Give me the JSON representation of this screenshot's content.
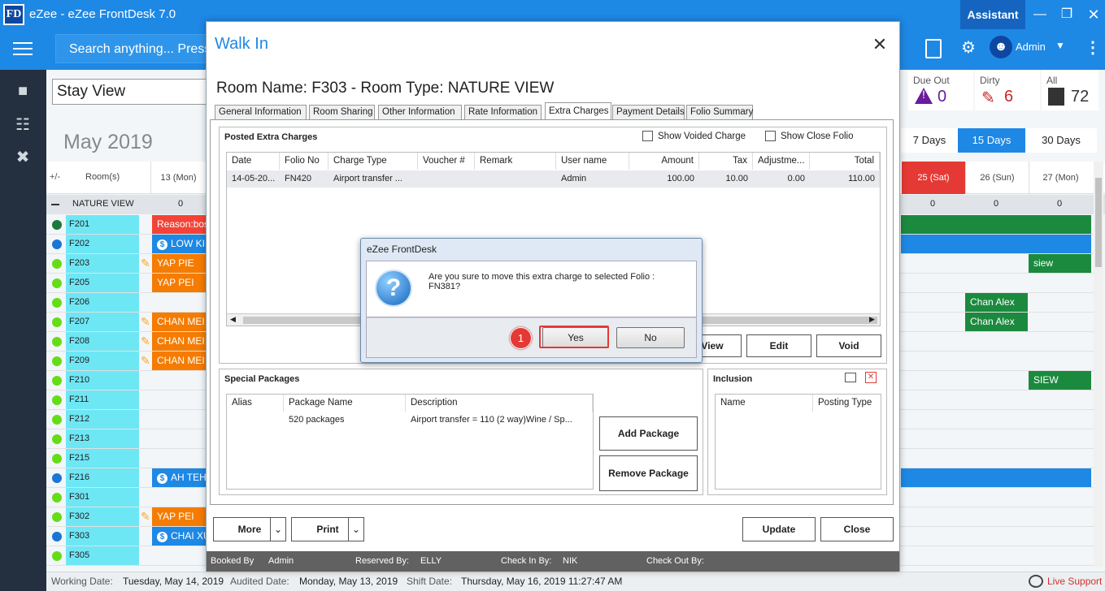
{
  "app": {
    "logo": "FD",
    "title": "eZee - eZee FrontDesk 7.0",
    "assistant_label": "Assistant",
    "user": "Admin"
  },
  "search": {
    "placeholder": "Search anything... Press"
  },
  "view": {
    "selected": "Stay View",
    "month": "May 2019"
  },
  "stats": {
    "due_out": {
      "label": "Due Out",
      "value": "0"
    },
    "dirty": {
      "label": "Dirty",
      "value": "6"
    },
    "all": {
      "label": "All",
      "value": "72"
    }
  },
  "range_buttons": [
    "7 Days",
    "15 Days",
    "30 Days"
  ],
  "grid": {
    "plusminus": "+/-",
    "rooms_header": "Room(s)",
    "dates": [
      "13 (Mon)",
      "25 (Sat)",
      "26 (Sun)",
      "27 (Mon)"
    ],
    "group": {
      "name": "NATURE VIEW",
      "counts": [
        "0",
        "0",
        "0",
        "0"
      ]
    },
    "rooms": [
      {
        "name": "F201",
        "dot": "#1b7a3a",
        "booking": "Reason:bos",
        "bcolor": "#f44336",
        "dollar": false,
        "broom": false
      },
      {
        "name": "F202",
        "dot": "#1976d2",
        "booking": "LOW KI",
        "bcolor": "#1e88e5",
        "dollar": true,
        "broom": false
      },
      {
        "name": "F203",
        "dot": "#64dd17",
        "booking": "YAP PIE",
        "bcolor": "#f57c00",
        "dollar": false,
        "broom": true
      },
      {
        "name": "F205",
        "dot": "#64dd17",
        "booking": "YAP PEI",
        "bcolor": "#f57c00",
        "dollar": false,
        "broom": false
      },
      {
        "name": "F206",
        "dot": "#64dd17",
        "booking": "",
        "bcolor": "",
        "dollar": false,
        "broom": false
      },
      {
        "name": "F207",
        "dot": "#64dd17",
        "booking": "CHAN MEI",
        "bcolor": "#f57c00",
        "dollar": false,
        "broom": true
      },
      {
        "name": "F208",
        "dot": "#64dd17",
        "booking": "CHAN MEI",
        "bcolor": "#f57c00",
        "dollar": false,
        "broom": true
      },
      {
        "name": "F209",
        "dot": "#64dd17",
        "booking": "CHAN MEI",
        "bcolor": "#f57c00",
        "dollar": false,
        "broom": true
      },
      {
        "name": "F210",
        "dot": "#64dd17",
        "booking": "",
        "bcolor": "",
        "dollar": false,
        "broom": false
      },
      {
        "name": "F211",
        "dot": "#64dd17",
        "booking": "",
        "bcolor": "",
        "dollar": false,
        "broom": false
      },
      {
        "name": "F212",
        "dot": "#64dd17",
        "booking": "",
        "bcolor": "",
        "dollar": false,
        "broom": false
      },
      {
        "name": "F213",
        "dot": "#64dd17",
        "booking": "",
        "bcolor": "",
        "dollar": false,
        "broom": false
      },
      {
        "name": "F215",
        "dot": "#64dd17",
        "booking": "",
        "bcolor": "",
        "dollar": false,
        "broom": false
      },
      {
        "name": "F216",
        "dot": "#1976d2",
        "booking": "AH TEH",
        "bcolor": "#1e88e5",
        "dollar": true,
        "broom": false
      },
      {
        "name": "F301",
        "dot": "#64dd17",
        "booking": "",
        "bcolor": "",
        "dollar": false,
        "broom": false
      },
      {
        "name": "F302",
        "dot": "#64dd17",
        "booking": "YAP PEI",
        "bcolor": "#f57c00",
        "dollar": false,
        "broom": true
      },
      {
        "name": "F303",
        "dot": "#1976d2",
        "booking": "CHAI XU",
        "bcolor": "#1e88e5",
        "dollar": true,
        "broom": false
      },
      {
        "name": "F305",
        "dot": "#64dd17",
        "booking": "",
        "bcolor": "",
        "dollar": false,
        "broom": false
      }
    ],
    "right_bookings": {
      "f203": "siew",
      "f207": "Chan Alex",
      "f208": "Chan Alex",
      "f210": "SIEW"
    }
  },
  "status": {
    "working_label": "Working Date:",
    "working": "Tuesday, May 14, 2019",
    "audited_label": "Audited Date:",
    "audited": "Monday, May 13, 2019",
    "shift_label": "Shift Date:",
    "shift": "Thursday, May 16, 2019 11:27:47 AM",
    "live_support": "Live Support"
  },
  "walkin": {
    "title": "Walk In",
    "room_title": "Room Name: F303 - Room Type: NATURE VIEW",
    "tabs": [
      "General Information",
      "Room Sharing",
      "Other Information",
      "Rate Information",
      "Extra Charges",
      "Payment Details",
      "Folio Summary"
    ],
    "posted": {
      "title": "Posted Extra Charges",
      "show_voided": "Show Voided Charge",
      "show_close_folio": "Show Close Folio",
      "headers": [
        "Date",
        "Folio No",
        "Charge Type",
        "Voucher #",
        "Remark",
        "User name",
        "Amount",
        "Tax",
        "Adjustme...",
        "Total"
      ],
      "row": [
        "14-05-20...",
        "FN420",
        "Airport transfer ...",
        "",
        "",
        "Admin",
        "100.00",
        "10.00",
        "0.00",
        "110.00"
      ],
      "buttons": [
        "View",
        "Edit",
        "Void"
      ]
    },
    "packages": {
      "title": "Special Packages",
      "headers": [
        "Alias",
        "Package Name",
        "Description"
      ],
      "row": [
        "",
        "520 packages",
        "Airport transfer = 110 (2 way)Wine / Sp..."
      ],
      "add": "Add Package",
      "remove": "Remove Package"
    },
    "inclusion": {
      "title": "Inclusion",
      "headers": [
        "Name",
        "Posting Type"
      ]
    },
    "buttons": {
      "more": "More",
      "print": "Print",
      "update": "Update",
      "close": "Close"
    },
    "footer": {
      "booked_label": "Booked By",
      "booked": "Admin",
      "reserved_label": "Reserved By:",
      "reserved": "ELLY",
      "checkin_label": "Check In By:",
      "checkin": "NIK",
      "checkout_label": "Check Out By:",
      "checkout": ""
    }
  },
  "confirm": {
    "title": "eZee FrontDesk",
    "message": "Are you sure to move this extra charge to selected Folio : FN381?",
    "yes": "Yes",
    "no": "No",
    "step": "1"
  }
}
